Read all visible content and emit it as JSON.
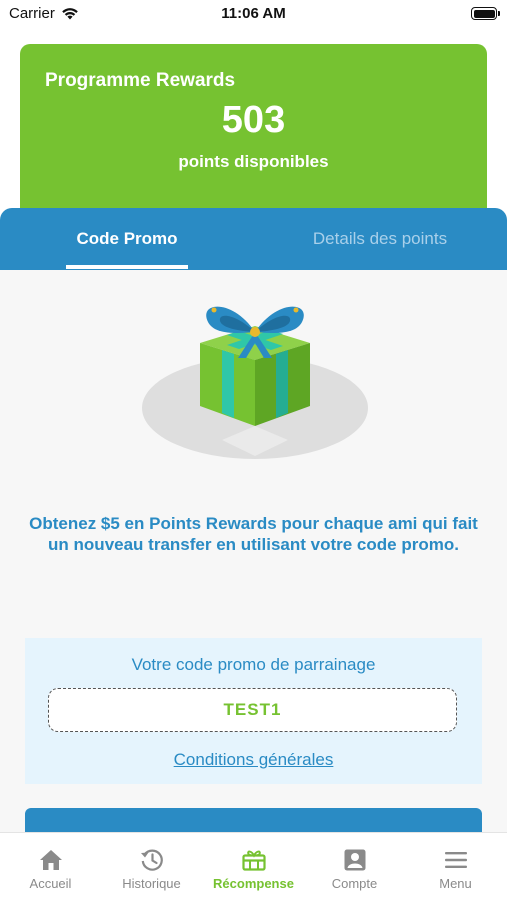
{
  "status_bar": {
    "carrier": "Carrier",
    "time": "11:06 AM"
  },
  "rewards": {
    "title": "Programme Rewards",
    "points": "503",
    "points_label": "points disponibles"
  },
  "tabs": [
    {
      "label": "Code Promo",
      "active": true
    },
    {
      "label": "Details des points",
      "active": false
    }
  ],
  "promo": {
    "message": "Obtenez $5 en Points Rewards pour chaque ami qui fait un nouveau transfer en utilisant votre code promo.",
    "referral_label": "Votre code promo de parrainage",
    "code": "TEST1",
    "conditions": "Conditions générales"
  },
  "bottom_nav": [
    {
      "label": "Accueil",
      "icon": "home-icon",
      "active": false
    },
    {
      "label": "Historique",
      "icon": "history-icon",
      "active": false
    },
    {
      "label": "Récompense",
      "icon": "gift-icon",
      "active": true
    },
    {
      "label": "Compte",
      "icon": "account-icon",
      "active": false
    },
    {
      "label": "Menu",
      "icon": "menu-icon",
      "active": false
    }
  ],
  "colors": {
    "brand_green": "#76c231",
    "brand_blue": "#2a8bc4",
    "light_blue_bg": "#e5f4fd",
    "nav_inactive": "#8a8a8a"
  }
}
